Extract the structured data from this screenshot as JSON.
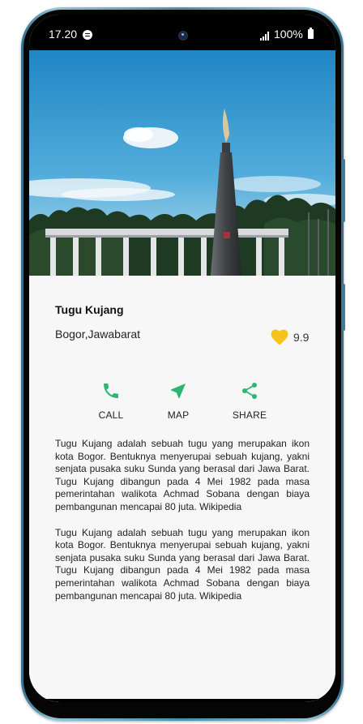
{
  "status_bar": {
    "time": "17.20",
    "battery": "100%"
  },
  "place": {
    "title": "Tugu Kujang",
    "location": "Bogor,Jawabarat",
    "rating": "9.9"
  },
  "actions": [
    {
      "label": "CALL",
      "icon": "phone-icon"
    },
    {
      "label": "MAP",
      "icon": "navigation-icon"
    },
    {
      "label": "SHARE",
      "icon": "share-icon"
    }
  ],
  "description": [
    "Tugu Kujang adalah sebuah tugu yang merupakan ikon kota Bogor. Bentuknya menyerupai sebuah kujang, yakni senjata pusaka suku Sunda yang berasal dari Jawa Barat. Tugu Kujang dibangun pada 4 Mei 1982 pada masa pemerintahan walikota Achmad Sobana dengan biaya pembangunan mencapai 80 juta. Wikipedia",
    " Tugu Kujang adalah sebuah tugu yang merupakan ikon kota Bogor. Bentuknya menyerupai sebuah kujang, yakni senjata pusaka suku Sunda yang berasal dari Jawa Barat. Tugu Kujang dibangun pada 4 Mei 1982 pada masa pemerintahan walikota Achmad Sobana dengan biaya pembangunan mencapai 80 juta. Wikipedia"
  ],
  "colors": {
    "accent_green": "#2bb673",
    "heart": "#f6c21b",
    "sky": "#3d9fd3"
  }
}
